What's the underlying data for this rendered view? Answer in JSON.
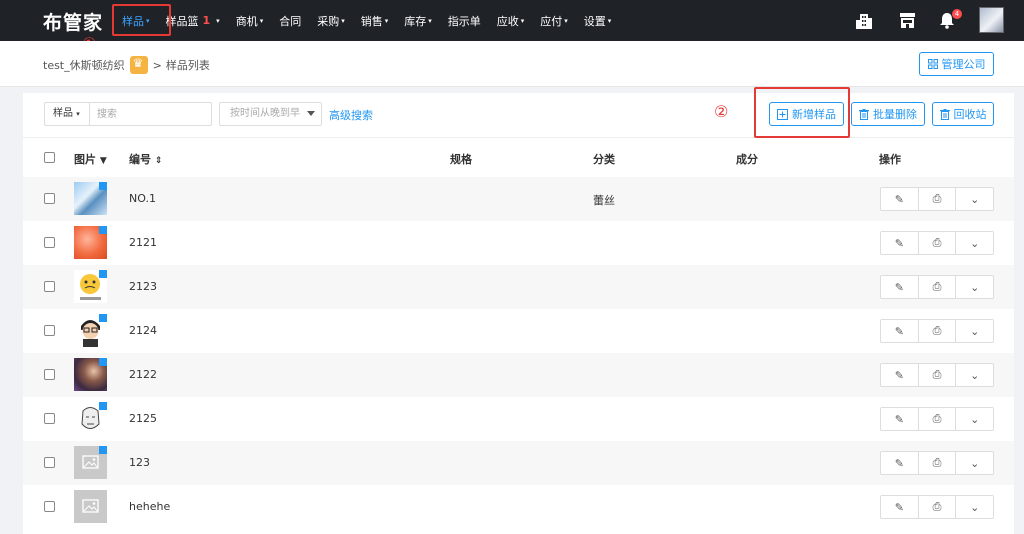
{
  "app": {
    "logo": "布管家"
  },
  "nav": [
    {
      "label": "样品",
      "caret": "▾",
      "active": true
    },
    {
      "label": "样品篮",
      "badge": "1",
      "caret": "▾"
    },
    {
      "label": "商机",
      "caret": "▾"
    },
    {
      "label": "合同",
      "caret": ""
    },
    {
      "label": "采购",
      "caret": "▾"
    },
    {
      "label": "销售",
      "caret": "▾"
    },
    {
      "label": "库存",
      "caret": "▾"
    },
    {
      "label": "指示单",
      "caret": ""
    },
    {
      "label": "应收",
      "caret": "▾"
    },
    {
      "label": "应付",
      "caret": "▾"
    },
    {
      "label": "设置",
      "caret": "▾"
    }
  ],
  "topright": {
    "bell_count": "4"
  },
  "annotations": {
    "one": "①",
    "two": "②"
  },
  "breadcrumb": {
    "company": "test_休斯顿纺织",
    "sep": ">",
    "page": "样品列表"
  },
  "manage_company": "管理公司",
  "filters": {
    "type": "样品",
    "type_caret": "▾",
    "search_placeholder": "搜索",
    "sort": "按时间从晚到早",
    "advanced": "高级搜索"
  },
  "toolbar": {
    "add": "新增样品",
    "batch_delete": "批量删除",
    "recycle": "回收站"
  },
  "table": {
    "headers": {
      "image": "图片",
      "code": "编号",
      "spec": "规格",
      "category": "分类",
      "composition": "成分",
      "actions": "操作"
    },
    "rows": [
      {
        "code": "NO.1",
        "spec": "",
        "category": "蕾丝",
        "composition": ""
      },
      {
        "code": "2121",
        "spec": "",
        "category": "",
        "composition": ""
      },
      {
        "code": "2123",
        "spec": "",
        "category": "",
        "composition": ""
      },
      {
        "code": "2124",
        "spec": "",
        "category": "",
        "composition": ""
      },
      {
        "code": "2122",
        "spec": "",
        "category": "",
        "composition": ""
      },
      {
        "code": "2125",
        "spec": "",
        "category": "",
        "composition": ""
      },
      {
        "code": "123",
        "spec": "",
        "category": "",
        "composition": ""
      },
      {
        "code": "hehehe",
        "spec": "",
        "category": "",
        "composition": ""
      }
    ]
  },
  "colors": {
    "accent": "#2196f3",
    "highlight": "#e53935",
    "topbar": "#1f2328"
  }
}
